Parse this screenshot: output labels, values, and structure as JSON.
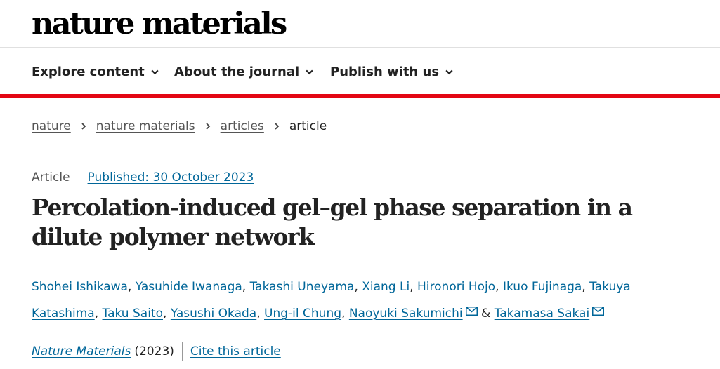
{
  "header": {
    "logo_text": "nature materials"
  },
  "nav": {
    "items": [
      {
        "label": "Explore content"
      },
      {
        "label": "About the journal"
      },
      {
        "label": "Publish with us"
      }
    ]
  },
  "breadcrumb": [
    "nature",
    "nature materials",
    "articles",
    "article"
  ],
  "article": {
    "type": "Article",
    "published": "Published: 30 October 2023",
    "title": "Percolation-induced gel–gel phase separation in a dilute polymer network",
    "authors": [
      "Shohei Ishikawa",
      "Yasuhide Iwanaga",
      "Takashi Uneyama",
      "Xiang Li",
      "Hironori Hojo",
      "Ikuo Fujinaga",
      "Takuya Katashima",
      "Taku Saito",
      "Yasushi Okada",
      "Ung-il Chung",
      "Naoyuki Sakumichi",
      "Takamasa Sakai"
    ],
    "separator": ",",
    "ampersand": "&",
    "journal": "Nature Materials",
    "year": "(2023)",
    "cite_label": "Cite this article"
  },
  "colors": {
    "accent_red": "#e30613",
    "link": "#006699",
    "text": "#222222"
  },
  "icons": {
    "nav_dropdown": "chevron-down-icon",
    "breadcrumb_sep": "chevron-right-icon",
    "corresponding_author": "mail-icon"
  }
}
